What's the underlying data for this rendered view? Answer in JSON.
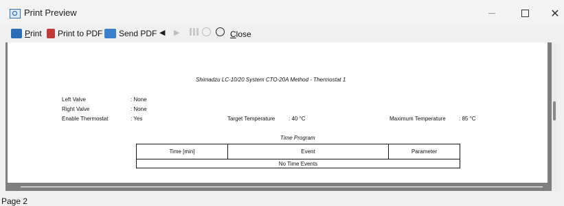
{
  "window": {
    "title": "Print Preview",
    "min_icon": "minimize-icon",
    "max_icon": "maximize-icon",
    "close_symbol": "✕"
  },
  "toolbar": {
    "print_label": "rint",
    "print_mnemonic": "P",
    "print_pdf_label": "Print to PDF",
    "send_pdf_label": "Send PDF",
    "prev_symbol": "◀",
    "next_symbol": "▶",
    "close_label": "lose",
    "close_mnemonic": "C"
  },
  "document": {
    "title": "Shimadzu  LC-10/20 System  CTO-20A Method - Thermostat 1",
    "left_valve_label": "Left Valve",
    "left_valve_value": ": None",
    "right_valve_label": "Right Valve",
    "right_valve_value": ": None",
    "enable_thermostat_label": "Enable Thermostat",
    "enable_thermostat_value": ": Yes",
    "target_temp_label": "Target Temperature",
    "target_temp_value": ": 40 °C",
    "max_temp_label": "Maximum Temperature",
    "max_temp_value": ": 85 °C",
    "time_program_title": "Time Program",
    "table_headers": [
      "Time [min]",
      "Event",
      "Parameter"
    ],
    "table_empty": "No Time Events"
  },
  "status": {
    "page": "Page 2"
  }
}
